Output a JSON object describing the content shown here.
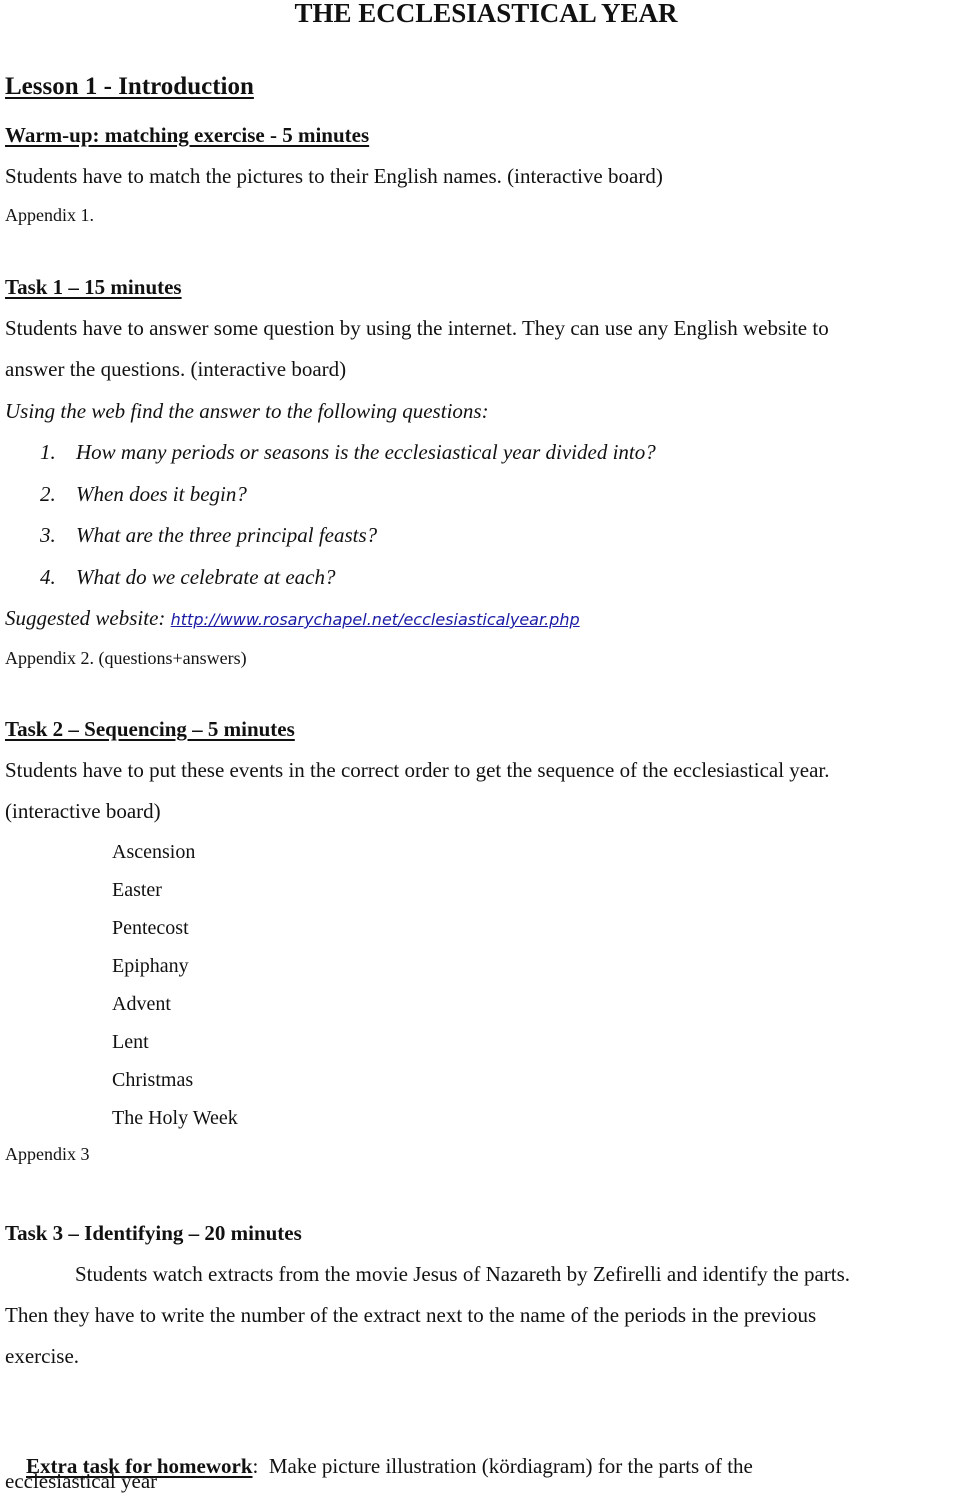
{
  "document": {
    "title": "THE ECCLESIASTICAL YEAR",
    "lesson_title": "Lesson 1 - Introduction"
  },
  "warmup": {
    "heading": "Warm-up: matching exercise - 5 minutes",
    "description": "Students have to match  the pictures to their English names. (interactive board)",
    "appendix": "Appendix 1."
  },
  "task1": {
    "heading": "Task 1 – 15 minutes",
    "description_line1": "Students have to answer some question by using the internet. They can use any English website to",
    "description_line2": "answer the questions. (interactive board)",
    "instruction": "Using the web find the answer to the following questions:",
    "questions": [
      {
        "number": "1.",
        "text": "How many periods or seasons is the ecclesiastical year divided into?"
      },
      {
        "number": "2.",
        "text": "When does it begin?"
      },
      {
        "number": "3.",
        "text": "What are the three principal feasts?"
      },
      {
        "number": "4.",
        "text": "What do we celebrate at each?"
      }
    ],
    "website_label": "Suggested website: ",
    "website_url": "http://www.rosarychapel.net/ecclesiasticalyear.php",
    "appendix": "Appendix 2. (questions+answers)"
  },
  "task2": {
    "heading": "Task 2 – Sequencing – 5 minutes",
    "description_line1": "Students have to put these events in the correct order to get the sequence of the ecclesiastical year.",
    "description_line2": "(interactive board)",
    "events": [
      "Ascension",
      "Easter",
      "Pentecost",
      "Epiphany",
      "Advent",
      "Lent",
      "Christmas",
      "The Holy Week"
    ],
    "appendix": "Appendix 3"
  },
  "task3": {
    "heading": "Task 3 – Identifying – 20 minutes",
    "description_line1": "Students watch extracts from the movie Jesus of Nazareth by Zefirelli and identify the parts.",
    "description_line2": "Then they have to write the number of the extract next to the name of the periods in the previous",
    "description_line3": "exercise."
  },
  "extra_task": {
    "label": "Extra task for homework",
    "separator": ":",
    "text_line1": "  Make picture illustration (kördiagram) for the parts of the",
    "text_line2": "ecclesiastical year"
  },
  "colors": {
    "link": "#1a1aa6",
    "text": "#111111"
  }
}
